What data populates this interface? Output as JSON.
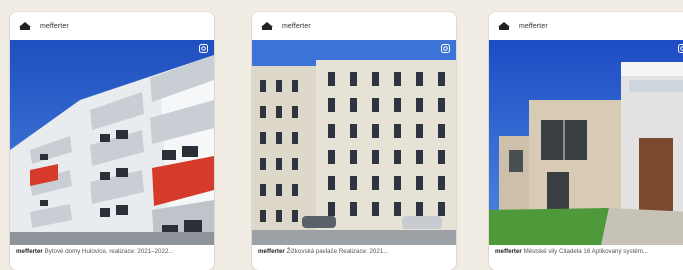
{
  "posts": [
    {
      "handle": "mefferter",
      "caption_text": "Bytové domy Hulovice, realizace: 2021–2022...",
      "icon": "instagram-icon"
    },
    {
      "handle": "mefferter",
      "caption_text": "Žižkovská pavlače Realizace: 2021...",
      "icon": "instagram-icon"
    },
    {
      "handle": "mefferter",
      "caption_text": "Městské vily Citadela 16 Aplikovaný systém...",
      "icon": "instagram-icon"
    }
  ],
  "colors": {
    "background": "#f1ede5",
    "accent_red": "#d63a2a",
    "sky": "#2f62c9"
  }
}
